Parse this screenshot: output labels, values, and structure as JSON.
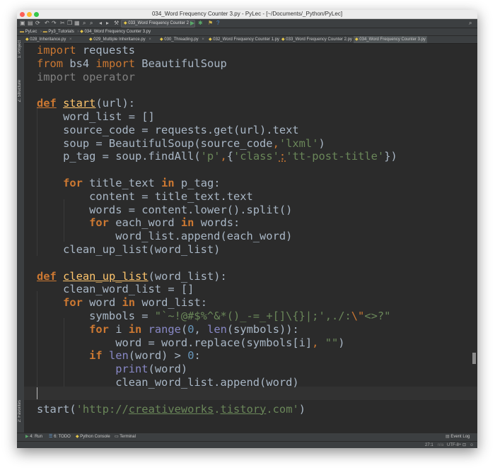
{
  "window": {
    "title": "034_Word Frequency Counter 3.py - PyLec - [~/Documents/_Python/PyLec]"
  },
  "toolbar": {
    "run_config": "033_Word Frequency Counter 2"
  },
  "breadcrumb": {
    "items": [
      "PyLec",
      "Py3_Tutorials",
      "034_Word Frequency Counter 3.py"
    ]
  },
  "tabs": [
    {
      "label": "028_Inheritance.py"
    },
    {
      "label": "029_Multiple Inheritance.py"
    },
    {
      "label": "030_Threading.py"
    },
    {
      "label": "032_Word Frequency Counter 1.py"
    },
    {
      "label": "033_Word Frequency Counter 2.py"
    },
    {
      "label": "034_Word Frequency Counter 3.py",
      "active": true
    }
  ],
  "left_panel": {
    "project": "1: Project",
    "structure": "Z: Structure",
    "favorites": "2: Favorites"
  },
  "bottom_tools": {
    "run": "4: Run",
    "todo": "6: TODO",
    "console": "Python Console",
    "terminal": "Terminal",
    "event_log": "Event Log"
  },
  "status": {
    "position": "27:1",
    "line_sep": "n/a",
    "encoding": "UTF-8÷"
  },
  "code": {
    "l1": [
      "import",
      " requests"
    ],
    "l2": [
      "from",
      " bs4 ",
      "import",
      " BeautifulSoup"
    ],
    "l3": [
      "import",
      " operator"
    ],
    "l5": [
      "def",
      " ",
      "start",
      "(url):"
    ],
    "l6": "    word_list = []",
    "l7": "    source_code = requests.get(url).text",
    "l8": [
      "    soup = BeautifulSoup(source_code",
      ",",
      "'lxml'",
      ")"
    ],
    "l9": [
      "    p_tag = soup.findAll(",
      "'p'",
      ",",
      "{",
      "'class'",
      ":",
      "'tt-post-title'",
      "})"
    ],
    "l11": [
      "    ",
      "for",
      " title_text ",
      "in",
      " p_tag:"
    ],
    "l12": "        content = title_text.text",
    "l13": "        words = content.lower().split()",
    "l14": [
      "        ",
      "for",
      " each_word ",
      "in",
      " words:"
    ],
    "l15": "            word_list.append(each_word)",
    "l16": "    clean_up_list(word_list)",
    "l18": [
      "def",
      " ",
      "clean_up_list",
      "(word_list):"
    ],
    "l19": "    clean_word_list = []",
    "l20": [
      "    ",
      "for",
      " word ",
      "in",
      " word_list:"
    ],
    "l21": [
      "        symbols = ",
      "\"`~!@#$%^&*()_-=_+[]\\{}|;',./:",
      "\\\"",
      "<>?\""
    ],
    "l22": [
      "        ",
      "for",
      " i ",
      "in",
      " ",
      "range",
      "(",
      "0",
      ", ",
      "len",
      "(symbols)):"
    ],
    "l23": [
      "            word = word.replace(symbols[i]",
      ",",
      " ",
      "\"\"",
      ")"
    ],
    "l24": [
      "        ",
      "if",
      " ",
      "len",
      "(word) > ",
      "0",
      ":"
    ],
    "l25": [
      "            ",
      "print",
      "(word)"
    ],
    "l26": "            clean_word_list.append(word)",
    "l28": [
      "start(",
      "'",
      "http://",
      "creativeworks",
      ".",
      "tistory",
      ".com",
      "'",
      ")"
    ]
  }
}
